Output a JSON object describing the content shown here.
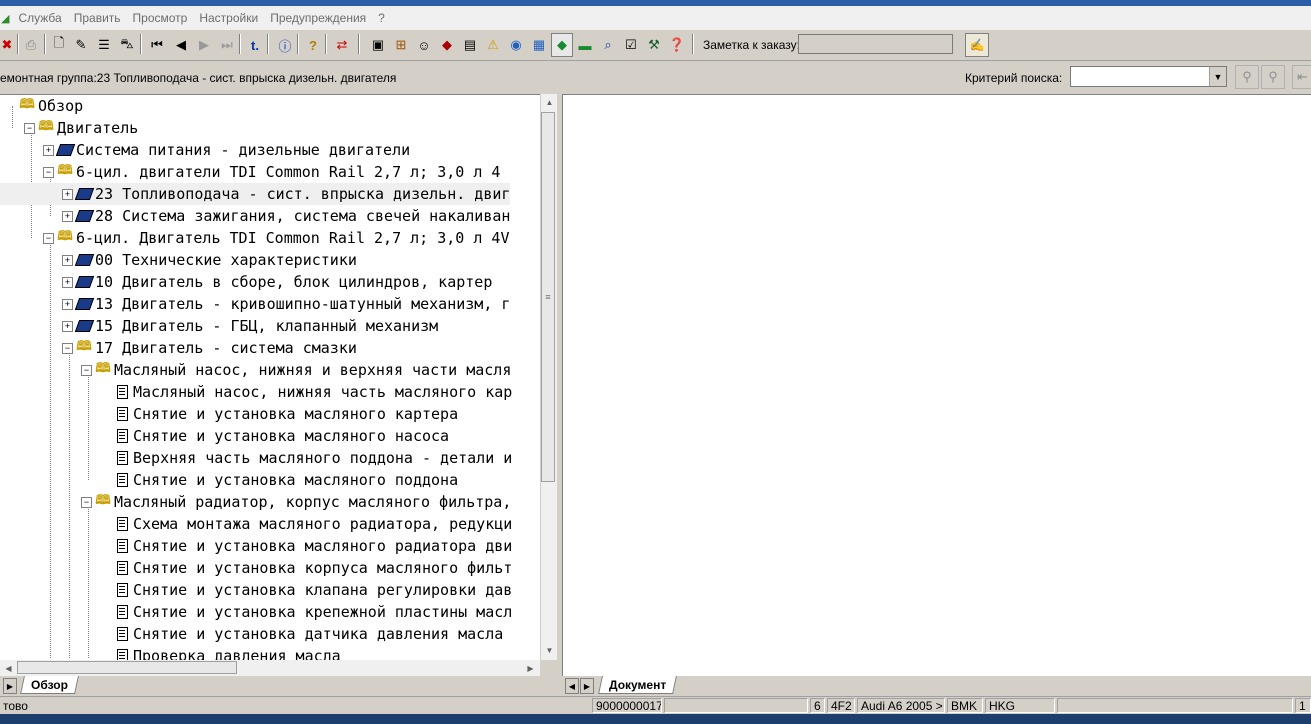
{
  "menu": [
    "Служба",
    "Править",
    "Просмотр",
    "Настройки",
    "Предупреждения",
    "?"
  ],
  "toolbar": {
    "note_label": "Заметка к заказу:",
    "note_value": ""
  },
  "pathbar": {
    "group": "емонтная группа:23 Топливоподача - сист. впрыска дизельн. двигателя",
    "criteria_label": "Критерий поиска:",
    "criteria_value": ""
  },
  "tree": [
    {
      "level": 0,
      "expander": "",
      "icon": "book-open",
      "label": "Обзор"
    },
    {
      "level": 1,
      "expander": "−",
      "icon": "book-open",
      "label": "Двигатель"
    },
    {
      "level": 2,
      "expander": "+",
      "icon": "book-closed",
      "label": "Система питания - дизельные двигатели"
    },
    {
      "level": 2,
      "expander": "−",
      "icon": "book-open",
      "label": "6-цил. двигатели TDI Common Rail 2,7 л; 3,0 л 4"
    },
    {
      "level": 3,
      "expander": "+",
      "icon": "book-closed",
      "label": "23 Топливоподача - сист. впрыска дизельн. двиг",
      "selected": true
    },
    {
      "level": 3,
      "expander": "+",
      "icon": "book-closed",
      "label": "28 Система зажигания, система свечей накаливан"
    },
    {
      "level": 2,
      "expander": "−",
      "icon": "book-open",
      "label": "6-цил. Двигатель TDI Common Rail 2,7 л; 3,0 л 4V"
    },
    {
      "level": 3,
      "expander": "+",
      "icon": "book-closed",
      "label": "00 Технические характеристики"
    },
    {
      "level": 3,
      "expander": "+",
      "icon": "book-closed",
      "label": "10 Двигатель в сборе, блок цилиндров, картер"
    },
    {
      "level": 3,
      "expander": "+",
      "icon": "book-closed",
      "label": "13 Двигатель - кривошипно-шатунный механизм, г"
    },
    {
      "level": 3,
      "expander": "+",
      "icon": "book-closed",
      "label": "15 Двигатель - ГБЦ, клапанный механизм"
    },
    {
      "level": 3,
      "expander": "−",
      "icon": "book-open",
      "label": "17 Двигатель - система смазки"
    },
    {
      "level": 4,
      "expander": "−",
      "icon": "book-open",
      "label": "Масляный насос, нижняя и верхняя части масля"
    },
    {
      "level": 5,
      "expander": "",
      "icon": "doc",
      "label": "Масляный насос, нижняя часть масляного кар"
    },
    {
      "level": 5,
      "expander": "",
      "icon": "doc",
      "label": "Снятие и установка масляного картера"
    },
    {
      "level": 5,
      "expander": "",
      "icon": "doc",
      "label": "Снятие и установка масляного насоса"
    },
    {
      "level": 5,
      "expander": "",
      "icon": "doc",
      "label": "Верхняя часть масляного поддона - детали и"
    },
    {
      "level": 5,
      "expander": "",
      "icon": "doc",
      "label": "Снятие и установка масляного поддона"
    },
    {
      "level": 4,
      "expander": "−",
      "icon": "book-open",
      "label": "Масляный радиатор, корпус масляного фильтра,"
    },
    {
      "level": 5,
      "expander": "",
      "icon": "doc",
      "label": "Схема монтажа масляного радиатора, редукци"
    },
    {
      "level": 5,
      "expander": "",
      "icon": "doc",
      "label": "Снятие и установка масляного радиатора дви"
    },
    {
      "level": 5,
      "expander": "",
      "icon": "doc",
      "label": "Снятие и установка корпуса масляного фильт"
    },
    {
      "level": 5,
      "expander": "",
      "icon": "doc",
      "label": "Снятие и установка клапана регулировки дав"
    },
    {
      "level": 5,
      "expander": "",
      "icon": "doc",
      "label": "Снятие и установка крепежной пластины масл"
    },
    {
      "level": 5,
      "expander": "",
      "icon": "doc",
      "label": "Снятие и установка датчика давления масла"
    },
    {
      "level": 5,
      "expander": "",
      "icon": "doc",
      "label": "Проверка давления масла"
    }
  ],
  "tabs": {
    "left": "Обзор",
    "right": "Документ"
  },
  "status": {
    "ready": "тово",
    "order": "9000000017",
    "c1": "6",
    "c2": "4F2",
    "model": "Audi A6 2005 >",
    "engine": "BMK",
    "gearbox": "HKG",
    "page": "1"
  },
  "icons": [
    "print-icon",
    "new-doc-icon",
    "edit-icon",
    "notes-icon",
    "car-icon",
    "first-icon",
    "prev-icon",
    "next-icon",
    "last-icon",
    "back-icon",
    "info-icon",
    "help-icon",
    "swap-icon"
  ],
  "colors": {
    "selection": "#efefef",
    "book": "#1a3a8a"
  }
}
